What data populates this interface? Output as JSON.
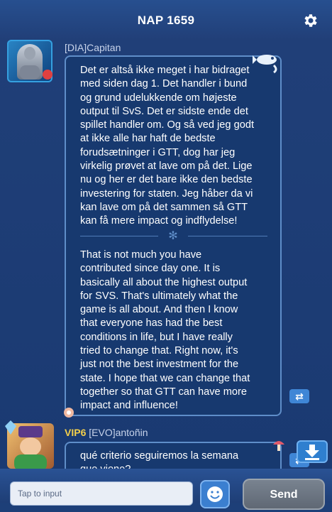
{
  "header": {
    "title": "NAP 1659",
    "settings_icon": "gear-icon"
  },
  "messages": [
    {
      "sender": "[DIA]Capitan",
      "vip": "",
      "original_text": "Det er altså ikke meget i har bidraget\nmed siden dag 1. Det handler i bund\nog grund udelukkende om højeste\noutput til SvS. Det er sidste ende det\nspillet handler om. Og så ved jeg godt\nat ikke alle har haft de bedste\nforudsætninger i GTT, dog har jeg\nvirkelig prøvet at lave om på det. Lige\nnu og her er det bare ikke den bedste\ninvestering for staten. Jeg håber da vi\nkan lave om på det sammen så GTT\nkan få mere impact og indflydelse!",
      "translated_text": "That is not much you have\ncontributed since day one. It is\nbasically all about the highest output\nfor SVS. That's ultimately what the\ngame is all about. And then I know\nthat everyone has had the best\nconditions in life, but I have really\ntried to change that. Right now, it's\njust not the best investment for the\nstate. I hope that we can change that\ntogether so that GTT can have more\nimpact and influence!",
      "translate_icon": "translate-icon"
    },
    {
      "sender": "[EVO]antoñin",
      "vip": "VIP6",
      "original_text": "qué criterio seguiremos la semana\nque viene?",
      "translate_icon": "translate-icon"
    }
  ],
  "input": {
    "placeholder": "Tap to input",
    "value": ""
  },
  "send_label": "Send",
  "emoji_icon": "emoji-icon",
  "download_icon": "download-icon",
  "colors": {
    "background": "#1d3f78",
    "bubble_fill": "#17396f",
    "bubble_border": "#5f8ec9",
    "vip": "#f3cf4b",
    "button_blue": "#3f86d6",
    "send_gray": "#6b7480"
  }
}
